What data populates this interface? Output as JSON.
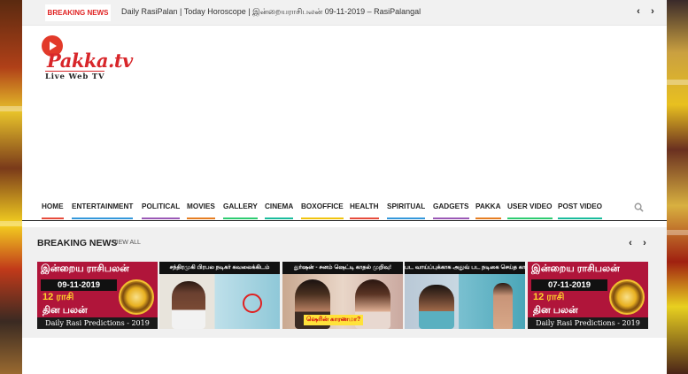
{
  "topbar": {
    "badge": "BREAKING NEWS",
    "ticker": "Daily RasiPalan | Today Horoscope | இன்றையராசிபலன் 09-11-2019 – RasiPalangal",
    "prev": "‹",
    "next": "›"
  },
  "logo": {
    "name": "Pakka.tv",
    "tagline": "Live Web TV"
  },
  "nav": {
    "items": [
      "HOME",
      "ENTERTAINMENT",
      "POLITICAL",
      "MOVIES",
      "GALLERY",
      "CINEMA",
      "BOXOFFICE",
      "HEALTH",
      "SPIRITUAL",
      "GADGETS",
      "PAKKA",
      "USER VIDEO",
      "POST VIDEO"
    ],
    "bar_colors": [
      "#e74c3c",
      "#3498db",
      "#9b59b6",
      "#e67e22",
      "#2ecc71",
      "#1abc9c",
      "#f1c40f",
      "#e74c3c",
      "#3498db",
      "#9b59b6",
      "#e67e22",
      "#2ecc71",
      "#1abc9c"
    ],
    "search_icon": "search-icon"
  },
  "breaking": {
    "title": "BREAKING NEWS",
    "view_all": "VIEW ALL",
    "prev": "‹",
    "next": "›",
    "cards": [
      {
        "type": "rasi",
        "line1": "இன்றைய ராசிபலன்",
        "date": "09-11-2019",
        "line2": "12 ராசி",
        "line3": "தின பலன்",
        "footer": "Daily Rasi Predictions - 2019"
      },
      {
        "type": "photo",
        "caption": "சந்திரமுகி பிரபல நடிகர் கவலைக்கிடம்"
      },
      {
        "type": "photo",
        "caption": "துர்ஷன் - சனம் ஷெட்டி காதல் முறிவு!",
        "label": "ஷெரின் காரணமா?"
      },
      {
        "type": "photo",
        "caption": "பட வாய்ப்புக்காக அதுவ் பட நடிகை செய்த காரியம் ரசிகர்கள் அதிர்ச்சி"
      },
      {
        "type": "rasi",
        "line1": "இன்றைய ராசிபலன்",
        "date": "07-11-2019",
        "line2": "12 ராசி",
        "line3": "தின பலன்",
        "footer": "Daily Rasi Predictions - 2019"
      }
    ]
  }
}
